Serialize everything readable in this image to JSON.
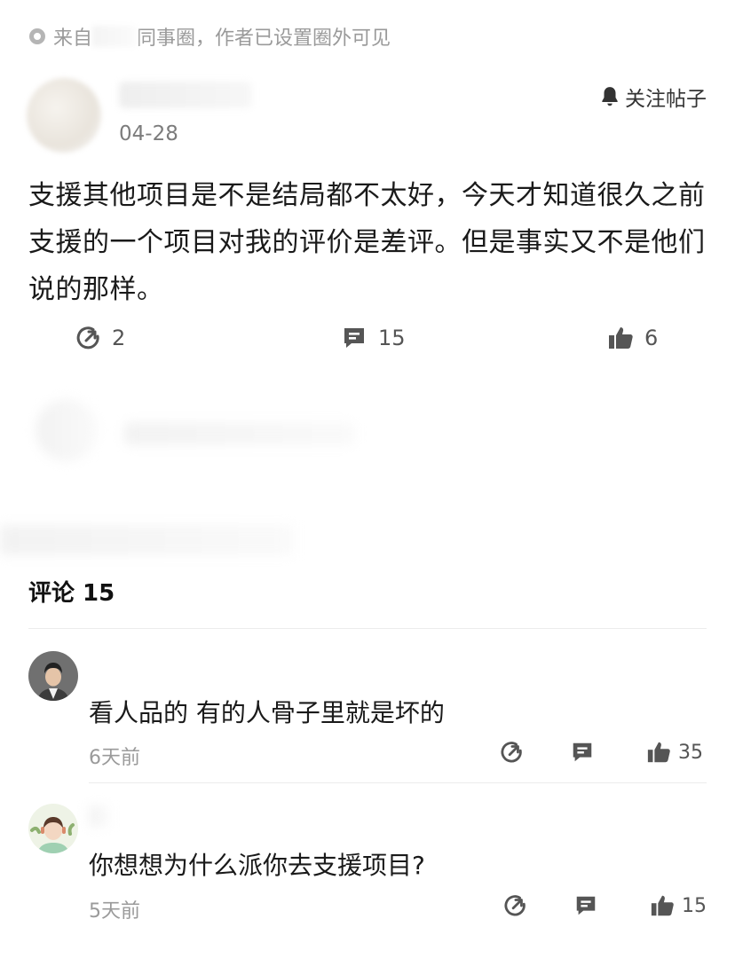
{
  "header": {
    "source_prefix": "来自",
    "source_suffix": "同事圈，作者已设置圈外可见"
  },
  "post": {
    "date": "04-28",
    "follow_label": "关注帖子",
    "body": "支援其他项目是不是结局都不太好，今天才知道很久之前支援的一个项目对我的评价是差评。但是事实又不是他们说的那样。",
    "share_count": "2",
    "comment_count": "15",
    "like_count": "6"
  },
  "comments_section": {
    "title": "评论 15",
    "comments": [
      {
        "text": "看人品的 有的人骨子里就是坏的",
        "time": "6天前",
        "likes": "35"
      },
      {
        "text": "你想想为什么派你去支援项目?",
        "time": "5天前",
        "likes": "15"
      }
    ]
  },
  "colors": {
    "text": "#1a1a1a",
    "muted": "#9a9a9a",
    "icon": "#555555"
  }
}
